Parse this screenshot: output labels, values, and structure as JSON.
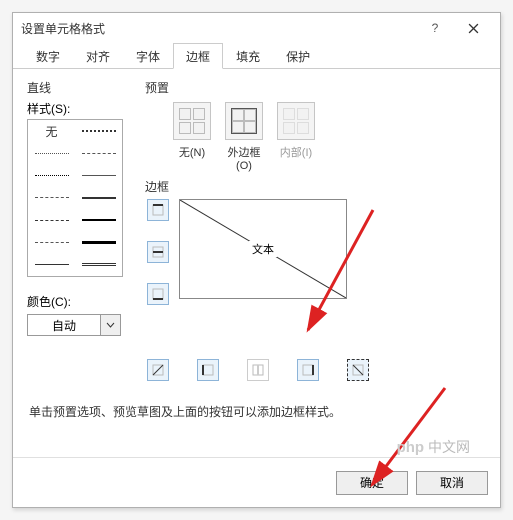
{
  "title": "设置单元格格式",
  "help": "?",
  "tabs": [
    "数字",
    "对齐",
    "字体",
    "边框",
    "填充",
    "保护"
  ],
  "active_tab": "边框",
  "line": {
    "section": "直线",
    "style_label": "样式(S):",
    "none": "无",
    "color_label": "颜色(C):",
    "color_value": "自动"
  },
  "presets": {
    "section": "预置",
    "labels": [
      "无(N)",
      "外边框(O)",
      "内部(I)"
    ]
  },
  "border": {
    "section": "边框",
    "preview_text": "文本"
  },
  "hint": "单击预置选项、预览草图及上面的按钮可以添加边框样式。",
  "footer": {
    "ok": "确定",
    "cancel": "取消"
  },
  "watermark": "中文网",
  "watermark_php": "php"
}
